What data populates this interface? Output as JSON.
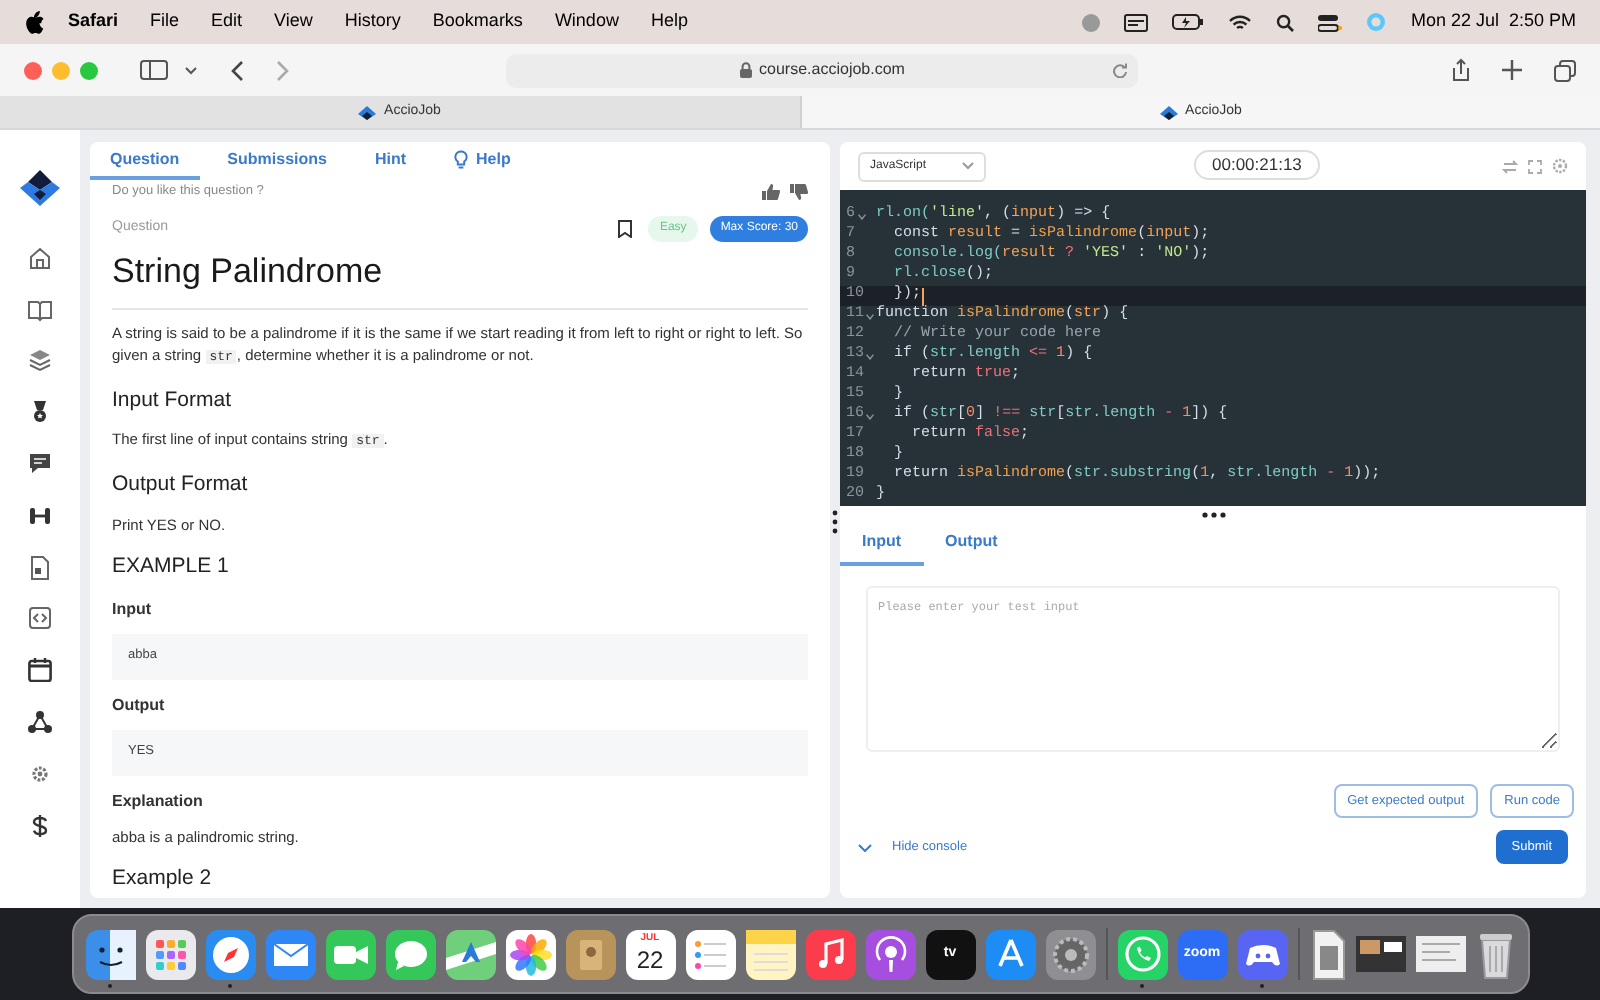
{
  "menubar": {
    "app": "Safari",
    "menus": [
      "File",
      "Edit",
      "View",
      "History",
      "Bookmarks",
      "Window",
      "Help"
    ],
    "clock": "Mon 22 Jul  2:50 PM"
  },
  "browser": {
    "url": "course.acciojob.com",
    "tabs": [
      {
        "label": "AccioJob",
        "selected": false
      },
      {
        "label": "AccioJob",
        "selected": true
      }
    ]
  },
  "question_tabs": [
    {
      "label": "Question",
      "selected": true,
      "kind": "text"
    },
    {
      "label": "Submissions",
      "selected": false,
      "kind": "text"
    },
    {
      "label": "Hint",
      "selected": false,
      "kind": "text"
    },
    {
      "label": "Help",
      "selected": false,
      "kind": "bulb"
    }
  ],
  "feedback_prompt": "Do you like this question ?",
  "question": {
    "section_label": "Question",
    "difficulty": "Easy",
    "max_score": "Max Score: 30",
    "title": "String Palindrome",
    "blocks": [
      {
        "kind": "paragraph",
        "parts": [
          {
            "kind": "text",
            "text": "A string is said to be a palindrome if it is the same if we start reading it from left to right or right to left. So given a string "
          },
          {
            "kind": "code",
            "text": "str"
          },
          {
            "kind": "text",
            "text": ", determine whether it is a palindrome or not."
          }
        ]
      },
      {
        "kind": "heading",
        "text": "Input Format"
      },
      {
        "kind": "paragraph",
        "parts": [
          {
            "kind": "text",
            "text": "The first line of input contains string "
          },
          {
            "kind": "code",
            "text": "str"
          },
          {
            "kind": "text",
            "text": "."
          }
        ]
      },
      {
        "kind": "heading",
        "text": "Output Format"
      },
      {
        "kind": "paragraph",
        "parts": [
          {
            "kind": "text",
            "text": "Print YES or NO."
          }
        ]
      },
      {
        "kind": "heading",
        "text": "EXAMPLE 1"
      },
      {
        "kind": "label",
        "text": "Input"
      },
      {
        "kind": "sample",
        "text": "abba"
      },
      {
        "kind": "label",
        "text": "Output"
      },
      {
        "kind": "sample",
        "text": "YES"
      },
      {
        "kind": "label",
        "text": "Explanation"
      },
      {
        "kind": "paragraph",
        "parts": [
          {
            "kind": "text",
            "text": "abba is a palindromic string."
          }
        ]
      },
      {
        "kind": "heading",
        "text": "Example 2"
      }
    ]
  },
  "editor": {
    "language": "JavaScript",
    "timer": "00:00:21:13",
    "lines": [
      {
        "number": "6",
        "foldable": true,
        "current": false,
        "segments": [
          {
            "kind": "prop",
            "text": "rl.on("
          },
          {
            "kind": "str",
            "text": "'line'"
          },
          {
            "kind": "plain",
            "text": ", ("
          },
          {
            "kind": "var",
            "text": "input"
          },
          {
            "kind": "plain",
            "text": ") => {"
          }
        ]
      },
      {
        "number": "7",
        "foldable": false,
        "current": false,
        "segments": [
          {
            "kind": "plain",
            "text": "  const "
          },
          {
            "kind": "var",
            "text": "result"
          },
          {
            "kind": "plain",
            "text": " = "
          },
          {
            "kind": "fn",
            "text": "isPalindrome"
          },
          {
            "kind": "plain",
            "text": "("
          },
          {
            "kind": "var",
            "text": "input"
          },
          {
            "kind": "plain",
            "text": ");"
          }
        ]
      },
      {
        "number": "8",
        "foldable": false,
        "current": false,
        "segments": [
          {
            "kind": "prop",
            "text": "  console.log("
          },
          {
            "kind": "var",
            "text": "result"
          },
          {
            "kind": "bool",
            "text": " ? "
          },
          {
            "kind": "str",
            "text": "'YES'"
          },
          {
            "kind": "plain",
            "text": " : "
          },
          {
            "kind": "str",
            "text": "'NO'"
          },
          {
            "kind": "plain",
            "text": ");"
          }
        ]
      },
      {
        "number": "9",
        "foldable": false,
        "current": false,
        "segments": [
          {
            "kind": "prop",
            "text": "  rl.close"
          },
          {
            "kind": "plain",
            "text": "();"
          }
        ]
      },
      {
        "number": "10",
        "foldable": false,
        "current": true,
        "segments": [
          {
            "kind": "plain",
            "text": "  });"
          }
        ]
      },
      {
        "number": "11",
        "foldable": true,
        "current": false,
        "segments": [
          {
            "kind": "plain",
            "text": "function "
          },
          {
            "kind": "fn",
            "text": "isPalindrome"
          },
          {
            "kind": "plain",
            "text": "("
          },
          {
            "kind": "var",
            "text": "str"
          },
          {
            "kind": "plain",
            "text": ") {"
          }
        ]
      },
      {
        "number": "12",
        "foldable": false,
        "current": false,
        "segments": [
          {
            "kind": "comment",
            "text": "  // Write your code here"
          }
        ]
      },
      {
        "number": "13",
        "foldable": true,
        "current": false,
        "segments": [
          {
            "kind": "plain",
            "text": "  if ("
          },
          {
            "kind": "prop",
            "text": "str.length"
          },
          {
            "kind": "bool",
            "text": " <= "
          },
          {
            "kind": "num",
            "text": "1"
          },
          {
            "kind": "plain",
            "text": ") {"
          }
        ]
      },
      {
        "number": "14",
        "foldable": false,
        "current": false,
        "segments": [
          {
            "kind": "plain",
            "text": "    return "
          },
          {
            "kind": "bool",
            "text": "true"
          },
          {
            "kind": "plain",
            "text": ";"
          }
        ]
      },
      {
        "number": "15",
        "foldable": false,
        "current": false,
        "segments": [
          {
            "kind": "plain",
            "text": "  }"
          }
        ]
      },
      {
        "number": "16",
        "foldable": true,
        "current": false,
        "segments": [
          {
            "kind": "plain",
            "text": "  if ("
          },
          {
            "kind": "prop",
            "text": "str"
          },
          {
            "kind": "plain",
            "text": "["
          },
          {
            "kind": "num",
            "text": "0"
          },
          {
            "kind": "plain",
            "text": "] "
          },
          {
            "kind": "bool",
            "text": "!=="
          },
          {
            "kind": "prop",
            "text": " str"
          },
          {
            "kind": "plain",
            "text": "["
          },
          {
            "kind": "prop",
            "text": "str.length"
          },
          {
            "kind": "bool",
            "text": " - "
          },
          {
            "kind": "num",
            "text": "1"
          },
          {
            "kind": "plain",
            "text": "]) {"
          }
        ]
      },
      {
        "number": "17",
        "foldable": false,
        "current": false,
        "segments": [
          {
            "kind": "plain",
            "text": "    return "
          },
          {
            "kind": "bool",
            "text": "false"
          },
          {
            "kind": "plain",
            "text": ";"
          }
        ]
      },
      {
        "number": "18",
        "foldable": false,
        "current": false,
        "segments": [
          {
            "kind": "plain",
            "text": "  }"
          }
        ]
      },
      {
        "number": "19",
        "foldable": false,
        "current": false,
        "segments": [
          {
            "kind": "plain",
            "text": "  return "
          },
          {
            "kind": "fn",
            "text": "isPalindrome"
          },
          {
            "kind": "plain",
            "text": "("
          },
          {
            "kind": "prop",
            "text": "str.substring"
          },
          {
            "kind": "plain",
            "text": "("
          },
          {
            "kind": "num",
            "text": "1"
          },
          {
            "kind": "plain",
            "text": ", "
          },
          {
            "kind": "prop",
            "text": "str.length"
          },
          {
            "kind": "bool",
            "text": " - "
          },
          {
            "kind": "num",
            "text": "1"
          },
          {
            "kind": "plain",
            "text": "));"
          }
        ]
      },
      {
        "number": "20",
        "foldable": false,
        "current": false,
        "segments": [
          {
            "kind": "plain",
            "text": "}"
          }
        ]
      }
    ]
  },
  "console": {
    "tabs": [
      {
        "label": "Input",
        "selected": true
      },
      {
        "label": "Output",
        "selected": false
      }
    ],
    "placeholder": "Please enter your test input",
    "buttons": [
      "Get expected output",
      "Run code"
    ],
    "toggle": "Hide console",
    "submit": "Submit"
  },
  "dock": [
    {
      "kind": "finder",
      "color": "#3b8fe8",
      "running": true
    },
    {
      "kind": "grid",
      "color": "#e9e9ee",
      "running": false
    },
    {
      "kind": "compass",
      "color": "#2a8cf0",
      "running": true
    },
    {
      "kind": "mail",
      "color": "#2f86f5",
      "running": false
    },
    {
      "kind": "camera",
      "color": "#34c759",
      "running": false
    },
    {
      "kind": "bubble",
      "color": "#34c759",
      "running": false
    },
    {
      "kind": "map",
      "color": "#6fcf7a",
      "running": false
    },
    {
      "kind": "flower",
      "color": "#ffffff",
      "running": false
    },
    {
      "kind": "book",
      "color": "#b8935a",
      "running": false
    },
    {
      "kind": "calendar",
      "color": "#ffffff",
      "running": false,
      "month": "JUL",
      "day": "22"
    },
    {
      "kind": "list",
      "color": "#ffffff",
      "running": false
    },
    {
      "kind": "notes",
      "color": "#fff4c2",
      "running": false
    },
    {
      "kind": "note",
      "color": "#fa3c4c",
      "running": false
    },
    {
      "kind": "podcast",
      "color": "#a54ee0",
      "running": false
    },
    {
      "kind": "label",
      "color": "#111111",
      "running": false,
      "label": "tv"
    },
    {
      "kind": "store",
      "color": "#1e8cf5",
      "running": false
    },
    {
      "kind": "gear",
      "color": "#8e8e93",
      "running": false
    },
    {
      "kind": "phone",
      "color": "#25d366",
      "running": true
    },
    {
      "kind": "label",
      "color": "#2d6cf5",
      "running": false,
      "label": "zoom"
    },
    {
      "kind": "controller",
      "color": "#5865f2",
      "running": true
    }
  ]
}
